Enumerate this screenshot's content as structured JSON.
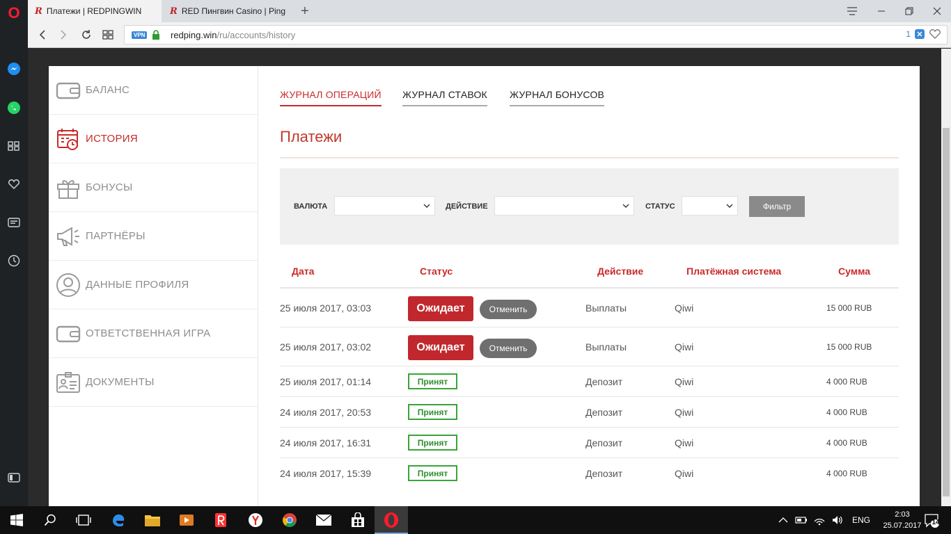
{
  "browser": {
    "tabs": [
      {
        "title": "Платежи | REDPINGWIN",
        "favicon": "R"
      },
      {
        "title": "RED Пингвин Casino | Ping",
        "favicon": "R"
      }
    ],
    "vpn_label": "VPN",
    "url_host": "redping.win",
    "url_path": "/ru/accounts/history",
    "badge_count": "1"
  },
  "sidebar": {
    "items": [
      {
        "label": "БАЛАНС",
        "icon": "wallet-icon"
      },
      {
        "label": "ИСТОРИЯ",
        "icon": "calendar-clock-icon"
      },
      {
        "label": "БОНУСЫ",
        "icon": "gift-icon"
      },
      {
        "label": "ПАРТНЁРЫ",
        "icon": "megaphone-icon"
      },
      {
        "label": "ДАННЫЕ ПРОФИЛЯ",
        "icon": "user-icon"
      },
      {
        "label": "ОТВЕТСТВЕННАЯ ИГРА",
        "icon": "wallet-icon"
      },
      {
        "label": "ДОКУМЕНТЫ",
        "icon": "id-card-icon"
      }
    ],
    "active_index": 1
  },
  "content_tabs": [
    "ЖУРНАЛ ОПЕРАЦИЙ",
    "ЖУРНАЛ СТАВОК",
    "ЖУРНАЛ БОНУСОВ"
  ],
  "page_title": "Платежи",
  "filters": {
    "currency_label": "ВАЛЮТА",
    "action_label": "ДЕЙСТВИЕ",
    "status_label": "СТАТУС",
    "button_label": "Фильтр"
  },
  "table": {
    "headers": [
      "Дата",
      "Статус",
      "Действие",
      "Платёжная система",
      "Сумма"
    ],
    "rows": [
      {
        "date": "25 июля 2017, 03:03",
        "status": "Ожидает",
        "cancel": "Отменить",
        "action": "Выплаты",
        "system": "Qiwi",
        "amount": "15 000 RUB"
      },
      {
        "date": "25 июля 2017, 03:02",
        "status": "Ожидает",
        "cancel": "Отменить",
        "action": "Выплаты",
        "system": "Qiwi",
        "amount": "15 000 RUB"
      },
      {
        "date": "25 июля 2017, 01:14",
        "status": "Принят",
        "action": "Депозит",
        "system": "Qiwi",
        "amount": "4 000 RUB"
      },
      {
        "date": "24 июля 2017, 20:53",
        "status": "Принят",
        "action": "Депозит",
        "system": "Qiwi",
        "amount": "4 000 RUB"
      },
      {
        "date": "24 июля 2017, 16:31",
        "status": "Принят",
        "action": "Депозит",
        "system": "Qiwi",
        "amount": "4 000 RUB"
      },
      {
        "date": "24 июля 2017, 15:39",
        "status": "Принят",
        "action": "Депозит",
        "system": "Qiwi",
        "amount": "4 000 RUB"
      }
    ]
  },
  "taskbar": {
    "language": "ENG",
    "time": "2:03",
    "date": "25.07.2017",
    "notifications": "14"
  },
  "colors": {
    "accent": "#c92a2a",
    "pending": "#c0282d",
    "accepted": "#38a538"
  }
}
